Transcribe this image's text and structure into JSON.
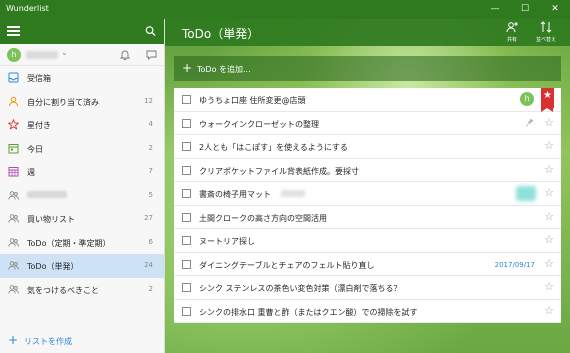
{
  "window": {
    "title": "Wunderlist",
    "minimize": "—",
    "maximize": "☐",
    "close": "✕"
  },
  "sidebar": {
    "user": {
      "avatar_initial": "h"
    },
    "lists": [
      {
        "label": "受信箱",
        "count": "",
        "icon": "inbox-icon"
      },
      {
        "label": "自分に割り当て済み",
        "count": "12",
        "icon": "assigned-icon"
      },
      {
        "label": "星付き",
        "count": "4",
        "icon": "star-icon"
      },
      {
        "label": "今日",
        "count": "2",
        "icon": "calendar-today-icon"
      },
      {
        "label": "週",
        "count": "7",
        "icon": "calendar-week-icon"
      },
      {
        "label": "",
        "count": "5",
        "icon": "shared-list-icon"
      },
      {
        "label": "買い物リスト",
        "count": "27",
        "icon": "shared-list-icon"
      },
      {
        "label": "ToDo（定期・準定期）",
        "count": "6",
        "icon": "shared-list-icon"
      },
      {
        "label": "ToDo（単発）",
        "count": "24",
        "icon": "shared-list-icon"
      },
      {
        "label": "気をつけるべきこと",
        "count": "2",
        "icon": "shared-list-icon"
      }
    ],
    "create_list_label": "リストを作成"
  },
  "main": {
    "title": "ToDo（単発）",
    "share_label": "共有",
    "sort_label": "並べ替え",
    "add_todo_placeholder": "ToDo を追加...",
    "tasks": [
      {
        "title": "ゆうちょ口座 住所変更@店頭",
        "starred": true,
        "assignee": "h",
        "due": ""
      },
      {
        "title": "ウォークインクローゼットの整理",
        "starred": false,
        "due": ""
      },
      {
        "title": "2人とも「はこぽす」を使えるようにする",
        "starred": false,
        "due": ""
      },
      {
        "title": "クリアポケットファイル背表紙作成。要採寸",
        "starred": false,
        "due": ""
      },
      {
        "title": "書斎の椅子用マット",
        "starred": false,
        "due": ""
      },
      {
        "title": "土間クロークの高さ方向の空間活用",
        "starred": false,
        "due": ""
      },
      {
        "title": "ヌートリア探し",
        "starred": false,
        "due": ""
      },
      {
        "title": "ダイニングテーブルとチェアのフェルト貼り直し",
        "starred": false,
        "due": "2017/09/17"
      },
      {
        "title": "シンク ステンレスの茶色い変色対策（漂白剤で落ちる？",
        "starred": false,
        "due": ""
      },
      {
        "title": "シンクの排水口 重曹と酢（またはクエン酸）での掃除を試す",
        "starred": false,
        "due": ""
      }
    ]
  },
  "colors": {
    "accent_green": "#2f7a1f",
    "star_red": "#d9322e",
    "link_blue": "#2b88d8",
    "selected_bg": "#cde3f5"
  }
}
